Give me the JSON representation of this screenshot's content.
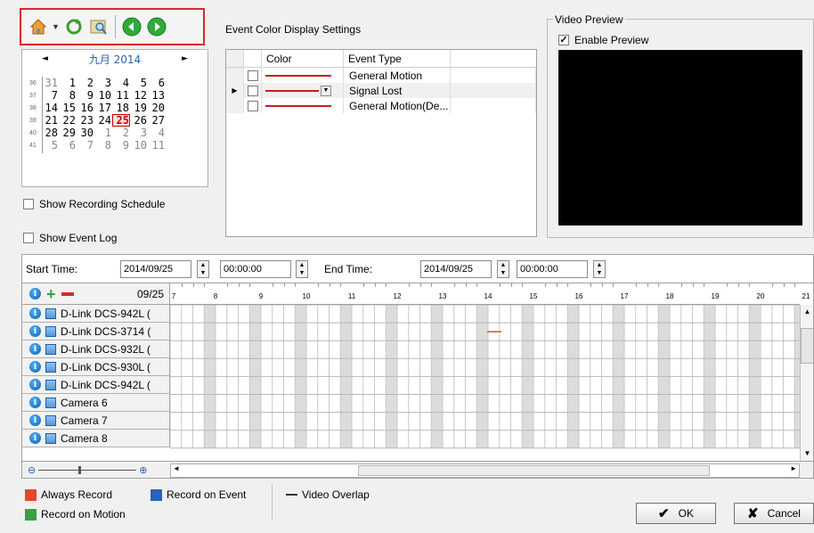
{
  "toolbar": {
    "buttons": [
      "home-icon",
      "refresh-icon",
      "search-icon",
      "previous-icon",
      "next-icon"
    ]
  },
  "calendar": {
    "month_label": "九月 2014",
    "prev_label": "◄",
    "next_label": "►",
    "weeks": [
      {
        "wk": "36",
        "days": [
          "31",
          "1",
          "2",
          "3",
          "4",
          "5",
          "6"
        ],
        "dim": [
          true,
          false,
          false,
          false,
          false,
          false,
          false
        ]
      },
      {
        "wk": "37",
        "days": [
          "7",
          "8",
          "9",
          "10",
          "11",
          "12",
          "13"
        ],
        "dim": [
          false,
          false,
          false,
          false,
          false,
          false,
          false
        ]
      },
      {
        "wk": "38",
        "days": [
          "14",
          "15",
          "16",
          "17",
          "18",
          "19",
          "20"
        ],
        "dim": [
          false,
          false,
          false,
          false,
          false,
          false,
          false
        ]
      },
      {
        "wk": "39",
        "days": [
          "21",
          "22",
          "23",
          "24",
          "25",
          "26",
          "27"
        ],
        "dim": [
          false,
          false,
          false,
          false,
          false,
          false,
          false
        ]
      },
      {
        "wk": "40",
        "days": [
          "28",
          "29",
          "30",
          "1",
          "2",
          "3",
          "4"
        ],
        "dim": [
          false,
          false,
          false,
          true,
          true,
          true,
          true
        ]
      },
      {
        "wk": "41",
        "days": [
          "5",
          "6",
          "7",
          "8",
          "9",
          "10",
          "11"
        ],
        "dim": [
          true,
          true,
          true,
          true,
          true,
          true,
          true
        ]
      }
    ],
    "today": "25"
  },
  "options": {
    "show_recording_schedule": "Show Recording Schedule",
    "show_event_log": "Show Event Log"
  },
  "event_settings": {
    "title": "Event Color Display Settings",
    "col_color": "Color",
    "col_event_type": "Event Type",
    "rows": [
      {
        "event_type": "General Motion",
        "color": "#c81e1e"
      },
      {
        "event_type": "Signal Lost",
        "color": "#c81e1e"
      },
      {
        "event_type": "General Motion(De...",
        "color": "#c81e1e"
      }
    ]
  },
  "video_preview": {
    "title": "Video Preview",
    "enable_label": "Enable Preview",
    "enabled": true
  },
  "timebar": {
    "start_label": "Start Time:",
    "start_date": "2014/09/25",
    "start_time": "00:00:00",
    "end_label": "End Time:",
    "end_date": "2014/09/25",
    "end_time": "00:00:00"
  },
  "timeline": {
    "date_label": "09/25",
    "hours": [
      "7",
      "8",
      "9",
      "10",
      "11",
      "12",
      "13",
      "14",
      "15",
      "16",
      "17",
      "18",
      "19",
      "20",
      "21"
    ],
    "cameras": [
      "D-Link DCS-942L (",
      "D-Link DCS-3714 (",
      "D-Link DCS-932L (",
      "D-Link DCS-930L (",
      "D-Link DCS-942L (",
      "Camera 6",
      "Camera 7",
      "Camera 8"
    ]
  },
  "legend": {
    "always_record": "Always Record",
    "record_on_event": "Record on Event",
    "record_on_motion": "Record on Motion",
    "video_overlap": "Video Overlap",
    "colors": {
      "always": "#e8452e",
      "event": "#2b62c0",
      "motion": "#3aa046"
    }
  },
  "buttons": {
    "ok": "OK",
    "cancel": "Cancel"
  }
}
